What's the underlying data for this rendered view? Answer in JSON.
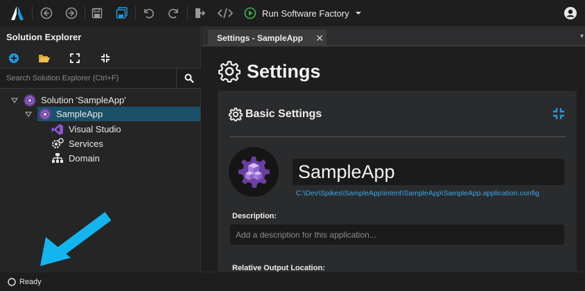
{
  "toolbar": {
    "run_label": "Run Software Factory",
    "icons": [
      "app-logo",
      "back",
      "forward",
      "save",
      "save-all",
      "undo",
      "redo",
      "export",
      "code",
      "run",
      "dropdown",
      "account"
    ]
  },
  "explorer": {
    "title": "Solution Explorer",
    "search_placeholder": "Search Solution Explorer (Ctrl+F)",
    "tree": [
      {
        "label": "Solution 'SampleApp'",
        "level": 0,
        "expanded": true,
        "icon": "solution-icon"
      },
      {
        "label": "SampleApp",
        "level": 1,
        "expanded": true,
        "selected": true,
        "icon": "application-icon"
      },
      {
        "label": "Visual Studio",
        "level": 2,
        "icon": "visual-studio-icon"
      },
      {
        "label": "Services",
        "level": 2,
        "icon": "services-icon"
      },
      {
        "label": "Domain",
        "level": 2,
        "icon": "domain-icon"
      }
    ]
  },
  "editor": {
    "tab_label": "Settings - SampleApp",
    "page_title": "Settings",
    "section_title": "Basic Settings",
    "app_name": "SampleApp",
    "config_path": "C:\\Dev\\Spikes\\SampleApp\\intent\\SampleApp\\SampleApp.application.config",
    "description_label": "Description:",
    "description_placeholder": "Add a description for this application...",
    "output_label": "Relative Output Location:"
  },
  "status": {
    "text": "Ready"
  },
  "colors": {
    "accent": "#1e9ae0",
    "selection": "#1a5068",
    "link": "#3ea8e6",
    "purple": "#6b3fa0",
    "annotation_arrow": "#13b5f0"
  }
}
